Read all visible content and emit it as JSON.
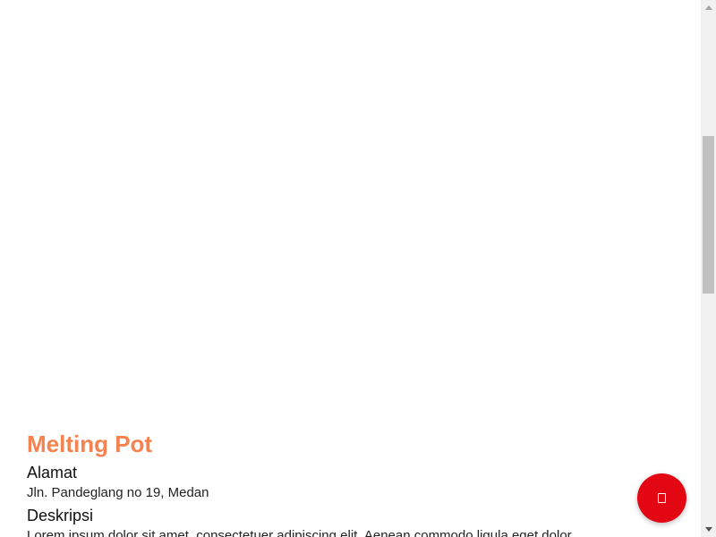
{
  "place": {
    "title": "Melting Pot",
    "address_heading": "Alamat",
    "address": "Jln. Pandeglang no 19, Medan",
    "description_heading": "Deskripsi",
    "description": "Lorem ipsum dolor sit amet, consectetuer adipiscing elit. Aenean commodo ligula eget dolor."
  },
  "fab": {
    "icon": "document-icon",
    "color": "#e30613"
  },
  "colors": {
    "title": "#f5824f",
    "fab": "#e30613"
  }
}
